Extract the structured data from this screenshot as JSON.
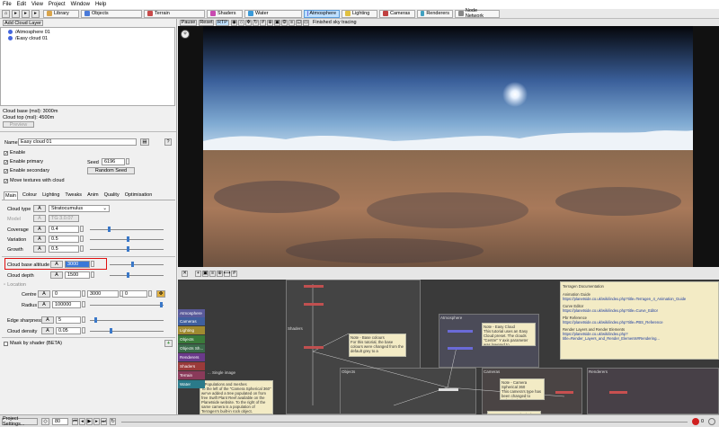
{
  "menu": [
    "File",
    "Edit",
    "View",
    "Project",
    "Window",
    "Help"
  ],
  "tabs": [
    {
      "label": "Library",
      "color": "#d9a44a"
    },
    {
      "label": "Objects",
      "color": "#4a7ad9"
    },
    {
      "label": "Terrain",
      "color": "#c84a4a"
    },
    {
      "label": "Shaders",
      "color": "#c84ab0"
    },
    {
      "label": "Water",
      "color": "#3a9ad9"
    },
    {
      "label": "Atmosphere",
      "color": "#6f6fe0"
    },
    {
      "label": "Lighting",
      "color": "#e0c040"
    },
    {
      "label": "Cameras",
      "color": "#c04040"
    },
    {
      "label": "Renderers",
      "color": "#40a0c0"
    },
    {
      "label": "Node Network",
      "color": "#888888"
    }
  ],
  "left": {
    "add_layer": "Add Cloud Layer",
    "tree": [
      "/Atmosphere 01",
      "/Easy cloud 01"
    ],
    "cloud_base": "Cloud base (msl): 3000m",
    "cloud_top": "Cloud top (msl): 4500m",
    "preview_btn": "Preview",
    "name_label": "Name",
    "name_value": "Easy cloud 01",
    "enable": "Enable",
    "enable_primary": "Enable primary",
    "enable_secondary": "Enable secondary",
    "move_textures": "Move textures with cloud",
    "seed_label": "Seed",
    "seed_value": "6196",
    "random_seed": "Random Seed",
    "subtabs": [
      "Main",
      "Colour",
      "Lighting",
      "Tweaks",
      "Anim",
      "Quality",
      "Optimisation"
    ],
    "cloud_type_label": "Cloud type",
    "cloud_type_value": "Stratocumulus",
    "model_label": "Model",
    "model_value": "TG 3.0.07",
    "coverage_label": "Coverage",
    "coverage_value": "0.4",
    "variation_label": "Variation",
    "variation_value": "0.5",
    "growth_label": "Growth",
    "growth_value": "0.5",
    "base_alt_label": "Cloud base altitude",
    "base_alt_value": "3000",
    "depth_label": "Cloud depth",
    "depth_value": "1500",
    "location_label": "Location",
    "centre_label": "Centre",
    "centre_x": "0",
    "centre_y": "3000",
    "centre_z": "0",
    "radius_label": "Radius",
    "radius_value": "100000",
    "edge_label": "Edge sharpness",
    "edge_value": "5",
    "density_label": "Cloud density",
    "density_value": "0.05",
    "mask_label": "Mask by shader (BETA)",
    "plus": "+"
  },
  "viewport": {
    "buttons": [
      "Pause",
      "Reset",
      "RTP"
    ],
    "status": "Finished sky tracing"
  },
  "nodes": {
    "categories": [
      {
        "label": "Atmosphere",
        "color": "#5a5a9a"
      },
      {
        "label": "Cameras",
        "color": "#3f5f9f"
      },
      {
        "label": "Lighting",
        "color": "#a08a30"
      },
      {
        "label": "Objects",
        "color": "#3a7a3a"
      },
      {
        "label": "Objects Sh...",
        "color": "#3a6a4a"
      },
      {
        "label": "Renderers",
        "color": "#6a3a8a"
      },
      {
        "label": "Shaders",
        "color": "#9a3a3a"
      },
      {
        "label": "Terrain",
        "color": "#8a3a5a"
      },
      {
        "label": "Water",
        "color": "#2a7a8a"
      }
    ],
    "groups": [
      "Atmosphere",
      "Shaders",
      "Objects",
      "Cameras",
      "Renderers"
    ],
    "note_base": "Note - Base colours",
    "note_base_text": "For this tutorial, the base colours were changed from the default grey to a",
    "note_easy": "Note - Easy Cloud",
    "note_easy_text": "This tutorial uses an Easy Cloud preset. The clouds \"Centre\" Y axis parameter was lowered to",
    "note_cam": "Note - Camera Spherical 360",
    "note_cam_text": "This camera's type has been changed to Spherical, and",
    "note_cam2": "Note - Camera Spherical Anim...",
    "note_pop": "...Populations and meshes",
    "note_pop_text": "To the left of the \"Camera Spherical 360\" we've added a tree populated on from free Swift Plant Reef available on the Planetside website. To the right of the same camera is a population of Terragen's built-in rock object.",
    "note_single": "... Single image",
    "doc_title": "Terragen Documentation",
    "doc_lines": [
      "Animation Guide",
      "https://planetside.co.uk/wiki/index.php?title=Terragen_4_Animation_Guide",
      "Curve Editor",
      "https://planetside.co.uk/wiki/index.php?title=Curve_Editor",
      "Pbr Reference",
      "https://planetside.co.uk/wiki/index.php?title=PBS_Reference",
      "Render Layers and Render Elements",
      "https://planetside.co.uk/wiki/index.php?title=Render_Layers_and_Render_Elements#Rendering..."
    ]
  },
  "bottom": {
    "project_settings": "Project Settings...",
    "frame": "80",
    "status_count": "0"
  }
}
